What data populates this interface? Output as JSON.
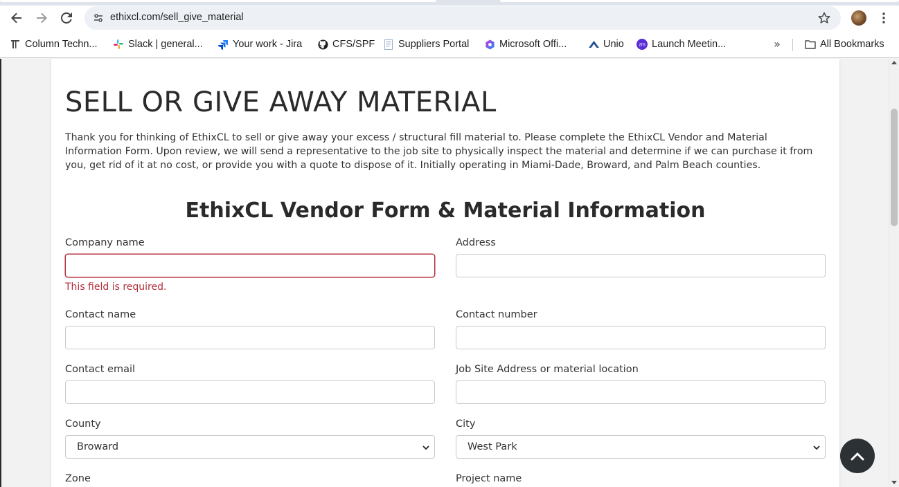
{
  "browser": {
    "url": "ethixcl.com/sell_give_material",
    "bookmarks": [
      {
        "label": "Column Techn...",
        "icon": "column-icon"
      },
      {
        "label": "Slack | general...",
        "icon": "slack-icon"
      },
      {
        "label": "Your work - Jira",
        "icon": "jira-icon"
      },
      {
        "label": "CFS/SPF",
        "icon": "github-icon"
      },
      {
        "label": "Suppliers Portal",
        "icon": "document-icon"
      },
      {
        "label": "Microsoft Offi...",
        "icon": "microsoft-office-icon"
      },
      {
        "label": "Unio",
        "icon": "unio-icon"
      },
      {
        "label": "Launch Meetin...",
        "icon": "zoom-icon"
      }
    ],
    "all_bookmarks_label": "All Bookmarks"
  },
  "page": {
    "title": "SELL OR GIVE AWAY MATERIAL",
    "intro": "Thank you for thinking of EthixCL to sell or give away your excess / structural fill material to. Please complete the EthixCL Vendor and Material Information Form. Upon review, we will send a representative to the job site to physically inspect the material and determine if we can purchase it from you, get rid of it at no cost, or provide you with a quote to dispose of it. Initially operating in Miami-Dade, Broward, and Palm Beach counties.",
    "form_title": "EthixCL Vendor Form & Material Information"
  },
  "form": {
    "company_name": {
      "label": "Company name",
      "value": "",
      "error": "This field is required."
    },
    "address": {
      "label": "Address",
      "value": ""
    },
    "contact_name": {
      "label": "Contact name",
      "value": ""
    },
    "contact_number": {
      "label": "Contact number",
      "value": ""
    },
    "contact_email": {
      "label": "Contact email",
      "value": ""
    },
    "job_site": {
      "label": "Job Site Address or material location",
      "value": ""
    },
    "county": {
      "label": "County",
      "selected": "Broward"
    },
    "city": {
      "label": "City",
      "selected": "West Park"
    },
    "zone": {
      "label": "Zone"
    },
    "project_name": {
      "label": "Project name"
    }
  },
  "colors": {
    "error": "#b3303b",
    "back_to_top": "#2c3136"
  }
}
